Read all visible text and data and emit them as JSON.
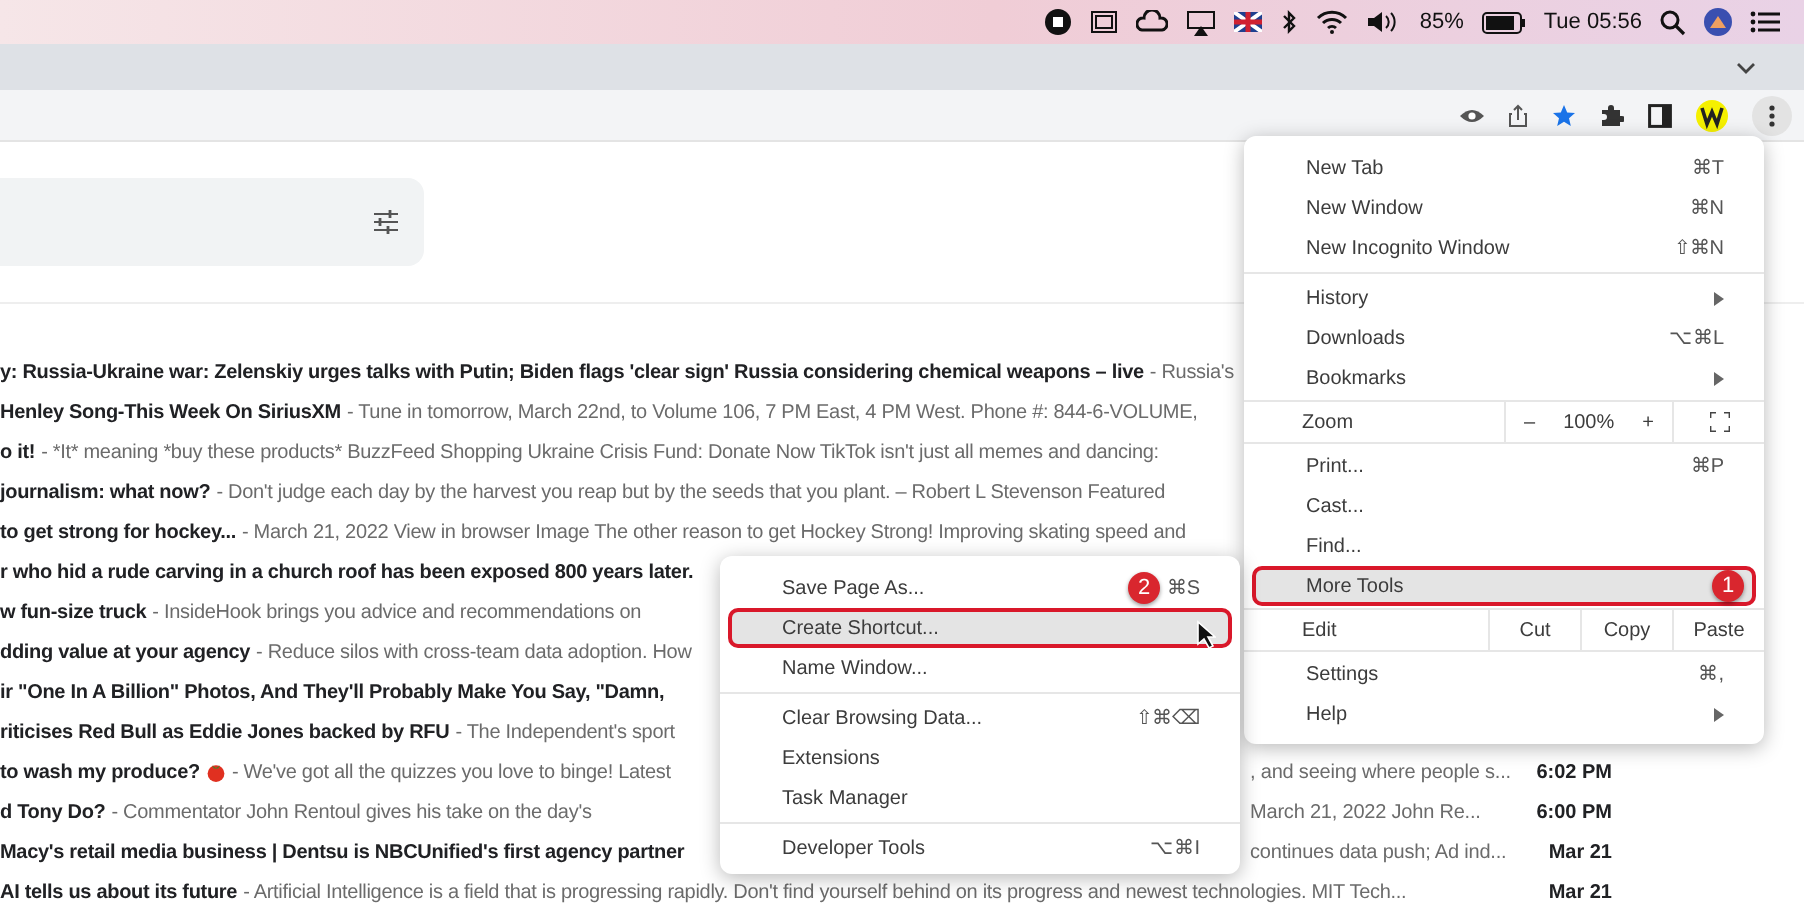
{
  "menubar": {
    "battery": "85%",
    "clock": "Tue 05:56"
  },
  "emails": [
    {
      "subject": "y: Russia-Ukraine war: Zelenskiy urges talks with Putin; Biden flags 'clear sign' Russia considering chemical weapons – live",
      "snippet": "- Russia's"
    },
    {
      "subject": "Henley Song-This Week On SiriusXM",
      "snippet": "- Tune in tomorrow, March 22nd, to Volume 106, 7 PM East, 4 PM West. Phone #: 844-6-VOLUME,"
    },
    {
      "subject": "o it!",
      "snippet": "- *It* meaning *buy these products* BuzzFeed Shopping Ukraine Crisis Fund: Donate Now TikTok isn't just all memes and dancing:"
    },
    {
      "subject": "journalism: what now?",
      "snippet": "- Don't judge each day by the harvest you reap but by the seeds that you plant. – Robert L Stevenson Featured"
    },
    {
      "subject": "to get strong for hockey...",
      "snippet": "- March 21, 2022 View in browser Image The other reason to get Hockey Strong! Improving skating speed and"
    },
    {
      "subject": "r who hid a rude carving in a church roof has been exposed 800 years later."
    },
    {
      "subject": "w fun-size truck",
      "snippet": "- InsideHook brings you advice and recommendations on"
    },
    {
      "subject": "dding value at your agency",
      "snippet": "- Reduce silos with cross-team data adoption. How"
    },
    {
      "subject": "ir \"One In A Billion\" Photos, And They'll Probably Make You Say, \"Damn,"
    },
    {
      "subject": "riticises Red Bull as Eddie Jones backed by RFU",
      "snippet": "- The Independent's sport"
    },
    {
      "subject": "to wash my produce?",
      "tomato": true,
      "snippet": "- We've got all the quizzes you love to binge! Latest",
      "tail": ", and seeing where people s...",
      "time": "6:02 PM"
    },
    {
      "subject": "d Tony Do?",
      "snippet": "- Commentator John Rentoul gives his take on the day's",
      "tail": "March 21, 2022 John Re...",
      "time": "6:00 PM"
    },
    {
      "subject": "Macy's retail media business | Dentsu is NBCUnified's first agency partner",
      "tail": "continues data push; Ad ind...",
      "time": "Mar 21"
    },
    {
      "subject": "AI tells us about its future",
      "snippet": "- Artificial Intelligence is a field that is progressing rapidly. Don't find yourself behind on its progress and newest technologies. MIT Tech...",
      "time": "Mar 21"
    }
  ],
  "main_menu": [
    {
      "kind": "item",
      "label": "New Tab",
      "shortcut": "⌘T",
      "submenu": false,
      "selected": false
    },
    {
      "kind": "item",
      "label": "New Window",
      "shortcut": "⌘N",
      "submenu": false,
      "selected": false
    },
    {
      "kind": "item",
      "label": "New Incognito Window",
      "shortcut": "⇧⌘N",
      "submenu": false,
      "selected": false
    },
    {
      "kind": "separator"
    },
    {
      "kind": "item",
      "label": "History",
      "submenu": true,
      "selected": false
    },
    {
      "kind": "item",
      "label": "Downloads",
      "shortcut": "⌥⌘L",
      "submenu": false,
      "selected": false
    },
    {
      "kind": "item",
      "label": "Bookmarks",
      "submenu": true,
      "selected": false
    },
    {
      "kind": "zoom",
      "label": "Zoom",
      "minus": "–",
      "value": "100%",
      "plus": "+"
    },
    {
      "kind": "item",
      "label": "Print...",
      "shortcut": "⌘P",
      "submenu": false,
      "selected": false
    },
    {
      "kind": "item",
      "label": "Cast...",
      "submenu": false,
      "selected": false
    },
    {
      "kind": "item",
      "label": "Find...",
      "submenu": false,
      "selected": false
    },
    {
      "kind": "item",
      "label": "More Tools",
      "submenu": true,
      "selected": true,
      "badge": "1"
    },
    {
      "kind": "edit",
      "label": "Edit",
      "actions": [
        "Cut",
        "Copy",
        "Paste"
      ]
    },
    {
      "kind": "item",
      "label": "Settings",
      "shortcut": "⌘,",
      "submenu": false,
      "selected": false
    },
    {
      "kind": "item",
      "label": "Help",
      "submenu": true,
      "selected": false
    }
  ],
  "submenu": [
    {
      "kind": "item",
      "label": "Save Page As...",
      "shortcut": "⌘S",
      "submenu": false,
      "selected": false,
      "badge": "2"
    },
    {
      "kind": "item",
      "label": "Create Shortcut...",
      "submenu": false,
      "selected": true,
      "pointer": true
    },
    {
      "kind": "item",
      "label": "Name Window...",
      "submenu": false,
      "selected": false
    },
    {
      "kind": "separator"
    },
    {
      "kind": "item",
      "label": "Clear Browsing Data...",
      "shortcut": "⇧⌘⌫",
      "submenu": false,
      "selected": false
    },
    {
      "kind": "item",
      "label": "Extensions",
      "submenu": false,
      "selected": false
    },
    {
      "kind": "item",
      "label": "Task Manager",
      "submenu": false,
      "selected": false
    },
    {
      "kind": "separator"
    },
    {
      "kind": "item",
      "label": "Developer Tools",
      "shortcut": "⌥⌘I",
      "submenu": false,
      "selected": false
    }
  ]
}
